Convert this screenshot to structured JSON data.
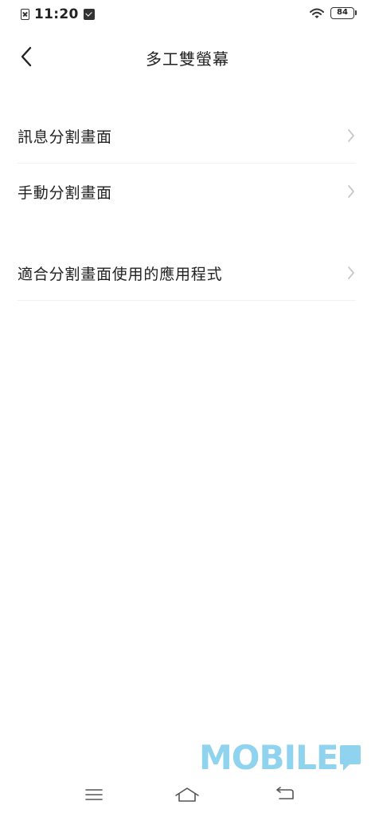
{
  "status_bar": {
    "time": "11:20",
    "battery": "84",
    "icons": [
      "sim-off-icon",
      "mail-icon",
      "wifi-icon",
      "battery-icon"
    ]
  },
  "header": {
    "title": "多工雙螢幕",
    "back_icon": "chevron-left-icon"
  },
  "menu": {
    "items": [
      {
        "label": "訊息分割畫面"
      },
      {
        "label": "手動分割畫面"
      },
      {
        "label": "適合分割畫面使用的應用程式"
      }
    ],
    "chevron_icon": "chevron-right-icon"
  },
  "watermark": {
    "text": "MOBILE",
    "color": "#8fd3ee"
  },
  "nav_bar": {
    "icons": [
      "menu-icon",
      "home-icon",
      "back-icon"
    ]
  },
  "colors": {
    "background": "#ffffff",
    "text": "#222222",
    "chevron": "#c8c8c8"
  }
}
